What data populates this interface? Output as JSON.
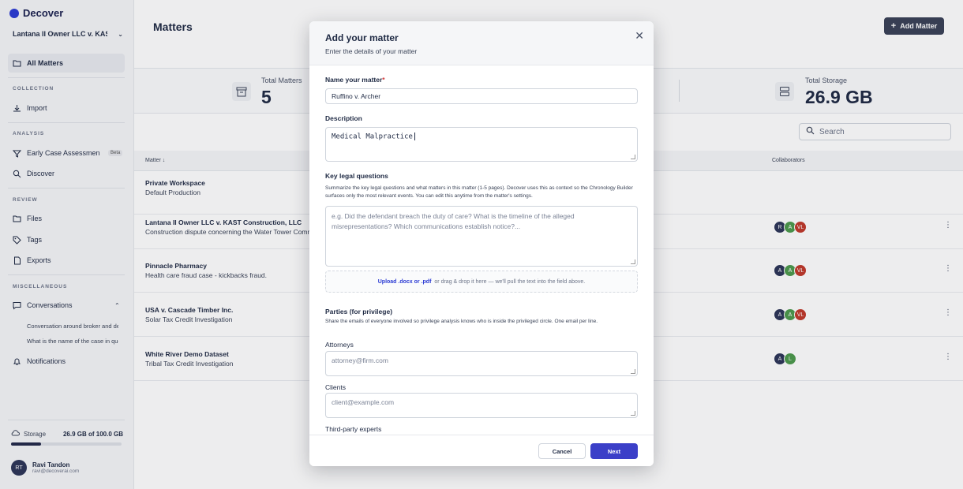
{
  "app": {
    "logo": "Decover",
    "workspace": "Lantana II Owner LLC v. KAST Construction, LLC"
  },
  "sidebar": {
    "all_matters": "All Matters",
    "collection_label": "COLLECTION",
    "import": "Import",
    "analysis_label": "ANALYSIS",
    "early_case": "Early Case Assessment",
    "beta": "Beta",
    "discover": "Discover",
    "review_label": "REVIEW",
    "files": "Files",
    "tags": "Tags",
    "exports": "Exports",
    "misc_label": "MISCELLANEOUS",
    "conversations": "Conversations",
    "conversation_items": [
      "Conversation around broker and deals",
      "What is the name of the case in question?"
    ],
    "notifications": "Notifications",
    "storage_label": "Storage",
    "storage_value": "26.9 GB of 100.0 GB",
    "storage_fraction": 0.269,
    "user_initials": "RT",
    "user_name": "Ravi Tandon",
    "user_email": "ravi@decoverai.com"
  },
  "main": {
    "title": "Matters",
    "add_matter": "Add Matter",
    "stats": {
      "total_matters_label": "Total Matters",
      "total_matters_value": "5",
      "total_storage_label": "Total Storage",
      "total_storage_value": "26.9 GB"
    },
    "search_placeholder": "Search",
    "columns": {
      "matter": "Matter",
      "collaborators": "Collaborators"
    },
    "rows": [
      {
        "title": "Private Workspace",
        "subtitle": "Default Production",
        "collaborators": []
      },
      {
        "title": "Lantana II Owner LLC v. KAST Construction, LLC",
        "subtitle": "Construction dispute concerning the Water Tower Commons project",
        "collaborators": [
          "R",
          "A",
          "VL"
        ]
      },
      {
        "title": "Pinnacle Pharmacy",
        "subtitle": "Health care fraud case - kickbacks fraud.",
        "collaborators": [
          "A",
          "A",
          "VL"
        ]
      },
      {
        "title": "USA v. Cascade Timber Inc.",
        "subtitle": "Solar Tax Credit Investigation",
        "collaborators": [
          "A",
          "A",
          "VL"
        ]
      },
      {
        "title": "White River Demo Dataset",
        "subtitle": "Tribal Tax Credit Investigation",
        "collaborators": [
          "A",
          "L"
        ]
      }
    ]
  },
  "modal": {
    "title": "Add your matter",
    "subtitle": "Enter the details of your matter",
    "name_label": "Name your matter",
    "name_required": "*",
    "name_value": "Ruffino v. Archer",
    "description_label": "Description",
    "description_value": "Medical Malpractice",
    "key_questions_label": "Key legal questions",
    "key_questions_help": "Summarize the key legal questions and what matters in this matter (1-5 pages). Decover uses this as context so the Chronology Builder surfaces only the most relevant events. You can edit this anytime from the matter's settings.",
    "key_questions_placeholder": "e.g. Did the defendant breach the duty of care? What is the timeline of the alleged misrepresentations? Which communications establish notice?...",
    "upload_link": "Upload .docx or .pdf",
    "upload_text": "or drag & drop it here — we'll pull the text into the field above.",
    "parties_label": "Parties (for privilege)",
    "parties_help": "Share the emails of everyone involved so privilege analysis knows who is inside the privileged circle. One email per line.",
    "attorneys_label": "Attorneys",
    "attorneys_placeholder": "attorney@firm.com",
    "clients_label": "Clients",
    "clients_placeholder": "client@example.com",
    "experts_label": "Third-party experts",
    "cancel": "Cancel",
    "next": "Next"
  },
  "colors": {
    "accent": "#3b3fc8",
    "chip_red": "#c0392b",
    "chip_green": "#4c9a4c",
    "chip_navy": "#2d3658"
  }
}
